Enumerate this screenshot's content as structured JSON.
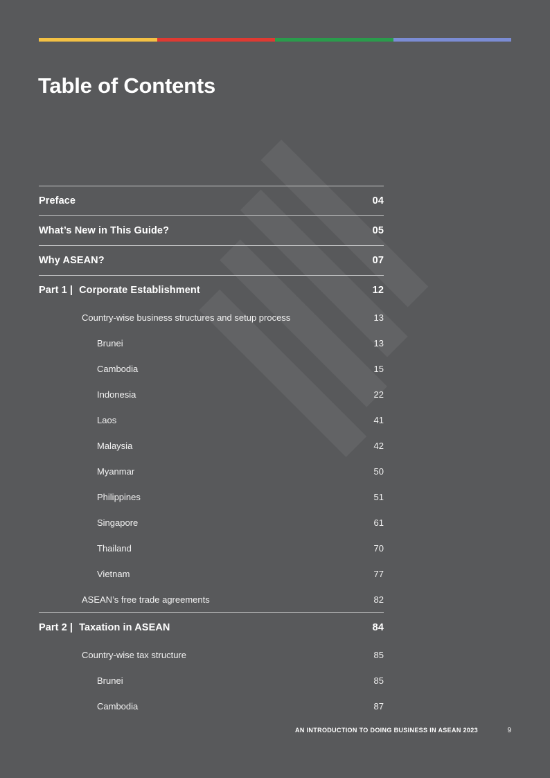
{
  "page": {
    "background_color": "#58595b",
    "title": "Table of Contents"
  },
  "colorbar": {
    "segments": [
      {
        "name": "yellow",
        "color": "#f3c144"
      },
      {
        "name": "red",
        "color": "#df3a32"
      },
      {
        "name": "green",
        "color": "#2a9c4c"
      },
      {
        "name": "blue",
        "color": "#7b8cd4"
      }
    ]
  },
  "toc": {
    "entries": [
      {
        "level": 1,
        "label": "Preface",
        "page": "04"
      },
      {
        "level": 1,
        "label": "What’s New in This Guide?",
        "page": "05"
      },
      {
        "level": 1,
        "label": "Why ASEAN?",
        "page": "07"
      },
      {
        "level": 1,
        "part": "Part 1",
        "separator": "|",
        "label": "Corporate Establishment",
        "page": "12"
      },
      {
        "level": 2,
        "label": "Country-wise business structures and setup process",
        "page": "13"
      },
      {
        "level": 3,
        "label": "Brunei",
        "page": "13"
      },
      {
        "level": 3,
        "label": "Cambodia",
        "page": "15"
      },
      {
        "level": 3,
        "label": "Indonesia",
        "page": "22"
      },
      {
        "level": 3,
        "label": "Laos",
        "page": "41"
      },
      {
        "level": 3,
        "label": "Malaysia",
        "page": "42"
      },
      {
        "level": 3,
        "label": "Myanmar",
        "page": "50"
      },
      {
        "level": 3,
        "label": "Philippines",
        "page": "51"
      },
      {
        "level": 3,
        "label": "Singapore",
        "page": "61"
      },
      {
        "level": 3,
        "label": "Thailand",
        "page": "70"
      },
      {
        "level": 3,
        "label": "Vietnam",
        "page": "77"
      },
      {
        "level": 2,
        "label": "ASEAN’s free trade agreements",
        "page": "82"
      },
      {
        "level": 1,
        "part": "Part 2",
        "separator": "|",
        "label": "Taxation in ASEAN",
        "page": "84"
      },
      {
        "level": 2,
        "label": "Country-wise tax structure",
        "page": "85"
      },
      {
        "level": 3,
        "label": "Brunei",
        "page": "85"
      },
      {
        "level": 3,
        "label": "Cambodia",
        "page": "87"
      }
    ]
  },
  "footer": {
    "title": "AN INTRODUCTION TO DOING BUSINESS IN ASEAN 2023",
    "page_number": "9"
  },
  "watermark": {
    "name": "diagonal-stripes-watermark",
    "color": "#626365",
    "angle_deg": 45,
    "bar_count": 4
  }
}
